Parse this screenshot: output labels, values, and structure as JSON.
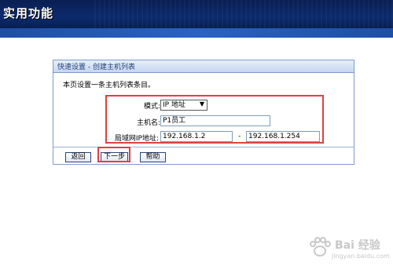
{
  "header": {
    "title": "实用功能"
  },
  "panel": {
    "title": "快速设置 - 创建主机列表",
    "description": "本页设置一条主机列表条目。",
    "form": {
      "mode_label": "模式:",
      "mode_value": "IP 地址",
      "hostname_label": "主机名:",
      "hostname_value": "P1员工",
      "lan_ip_label": "局域网IP地址:",
      "ip_start": "192.168.1.2",
      "ip_separator": "-",
      "ip_end": "192.168.1.254"
    },
    "buttons": {
      "back": "返回",
      "next": "下一步",
      "help": "帮助"
    }
  },
  "watermark": {
    "text": "Bai 经验",
    "sub": "jingyan.baidu.com"
  },
  "colors": {
    "banner": "#0c2a6e",
    "stripe": "#2a62c2",
    "highlight": "#e04045",
    "panel_border": "#7d9bd1"
  }
}
